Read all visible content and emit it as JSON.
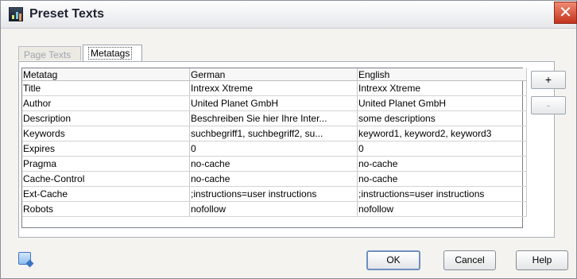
{
  "window": {
    "title": "Preset Texts",
    "close_glyph": "✕"
  },
  "tabs": [
    {
      "label": "Page Texts",
      "active": false
    },
    {
      "label": "Metatags",
      "active": true
    }
  ],
  "table": {
    "columns": [
      "Metatag",
      "German",
      "English"
    ],
    "rows": [
      [
        "Title",
        "Intrexx Xtreme",
        "Intrexx Xtreme"
      ],
      [
        "Author",
        "United Planet GmbH",
        "United Planet GmbH"
      ],
      [
        "Description",
        "Beschreiben Sie hier Ihre Inter...",
        "some descriptions"
      ],
      [
        "Keywords",
        "suchbegriff1, suchbegriff2, su...",
        "keyword1, keyword2, keyword3"
      ],
      [
        "Expires",
        "0",
        "0"
      ],
      [
        "Pragma",
        "no-cache",
        "no-cache"
      ],
      [
        "Cache-Control",
        "no-cache",
        "no-cache"
      ],
      [
        "Ext-Cache",
        ";instructions=user instructions",
        ";instructions=user instructions"
      ],
      [
        "Robots",
        "nofollow",
        "nofollow"
      ]
    ]
  },
  "side_buttons": {
    "add": "+",
    "remove": "-"
  },
  "buttons": {
    "ok": "OK",
    "cancel": "Cancel",
    "help": "Help"
  },
  "icons": {
    "app": "preset-texts-app-icon",
    "help": "help-icon"
  }
}
